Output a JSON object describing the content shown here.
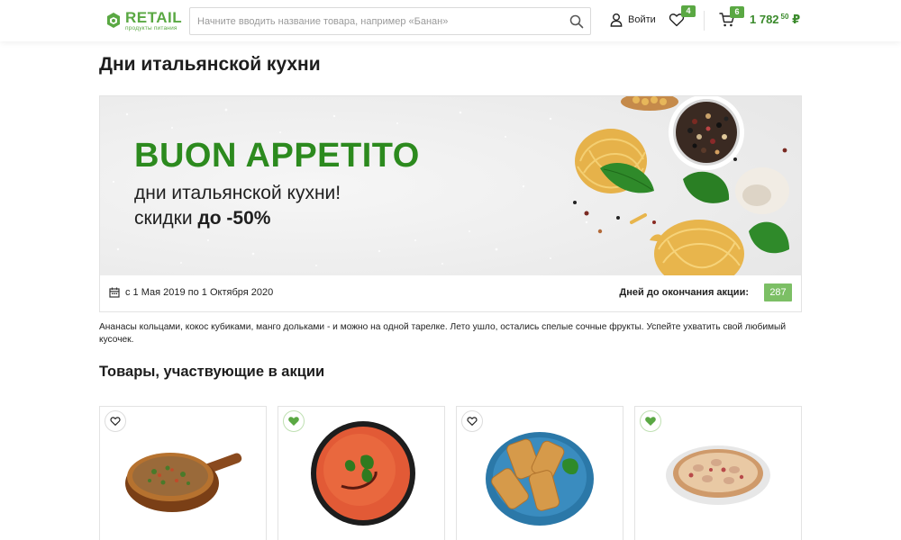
{
  "header": {
    "logo_text": "RETAIL",
    "logo_sub": "продукты питания",
    "search_placeholder": "Начните вводить название товара, например «Банан»",
    "login_label": "Войти",
    "favorites_count": "4",
    "cart_count": "6",
    "cart_total_main": "1 782",
    "cart_total_cents": "50",
    "cart_currency": "₽"
  },
  "page": {
    "title": "Дни итальянской кухни"
  },
  "banner": {
    "headline": "BUON APPETITO",
    "line1": "дни итальянской кухни!",
    "line2_prefix": "скидки ",
    "line2_bold": "до -50%"
  },
  "promo": {
    "dates": "с 1 Мая 2019 по 1 Октября 2020",
    "days_label": "Дней до окончания акции:",
    "days_value": "287"
  },
  "description": "Ананасы кольцами, кокос кубиками, манго дольками - и можно на одной тарелке. Лето ушло, остались спелые сочные фрукты. Успейте ухватить свой любимый кусочек.",
  "products_section": {
    "title": "Товары, участвующие в акции",
    "items": [
      {
        "image": "pizza-on-board",
        "favorite": false
      },
      {
        "image": "tomato-soup",
        "favorite": true
      },
      {
        "image": "spring-rolls",
        "favorite": false
      },
      {
        "image": "mushroom-pizza",
        "favorite": true
      }
    ]
  },
  "colors": {
    "brand_green": "#5aa843",
    "headline_green": "#2c8a1e",
    "badge_green": "#7cbf65"
  },
  "icons": {
    "search": "search-icon",
    "user": "user-icon",
    "heart": "heart-icon",
    "cart": "cart-icon",
    "calendar": "calendar-icon"
  }
}
